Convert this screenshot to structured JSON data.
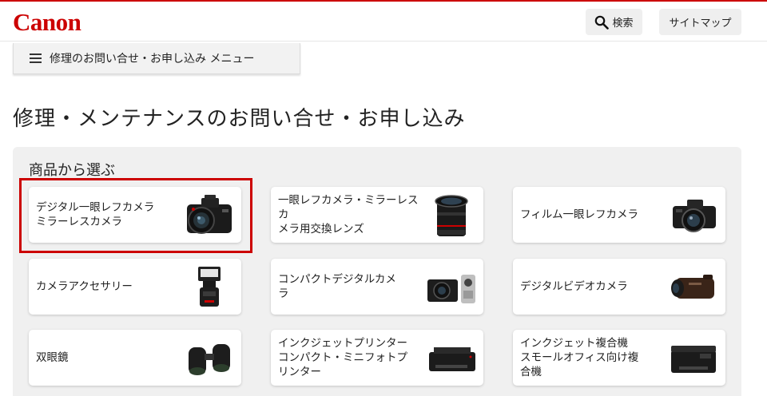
{
  "brand": {
    "logo_text": "Canon",
    "accent": "#cc0000"
  },
  "header": {
    "search_label": "検索",
    "sitemap_label": "サイトマップ"
  },
  "menu": {
    "label": "修理のお問い合せ・お申し込み メニュー"
  },
  "page": {
    "title": "修理・メンテナンスのお問い合せ・お申し込み"
  },
  "section": {
    "heading": "商品から選ぶ"
  },
  "products": [
    {
      "label": "デジタル一眼レフカメラ\nミラーレスカメラ",
      "icon": "dslr-camera-icon"
    },
    {
      "label": "一眼レフカメラ・ミラーレスカ\nメラ用交換レンズ",
      "icon": "lens-icon"
    },
    {
      "label": "フィルム一眼レフカメラ",
      "icon": "film-camera-icon"
    },
    {
      "label": "カメラアクセサリー",
      "icon": "flash-icon"
    },
    {
      "label": "コンパクトデジタルカメ\nラ",
      "icon": "compact-camera-icon"
    },
    {
      "label": "デジタルビデオカメラ",
      "icon": "video-camera-icon"
    },
    {
      "label": "双眼鏡",
      "icon": "binoculars-icon"
    },
    {
      "label": "インクジェットプリンター\nコンパクト・ミニフォトプ\nリンター",
      "icon": "printer-icon"
    },
    {
      "label": "インクジェット複合機\nスモールオフィス向け複\n合機",
      "icon": "multifunction-printer-icon"
    }
  ]
}
